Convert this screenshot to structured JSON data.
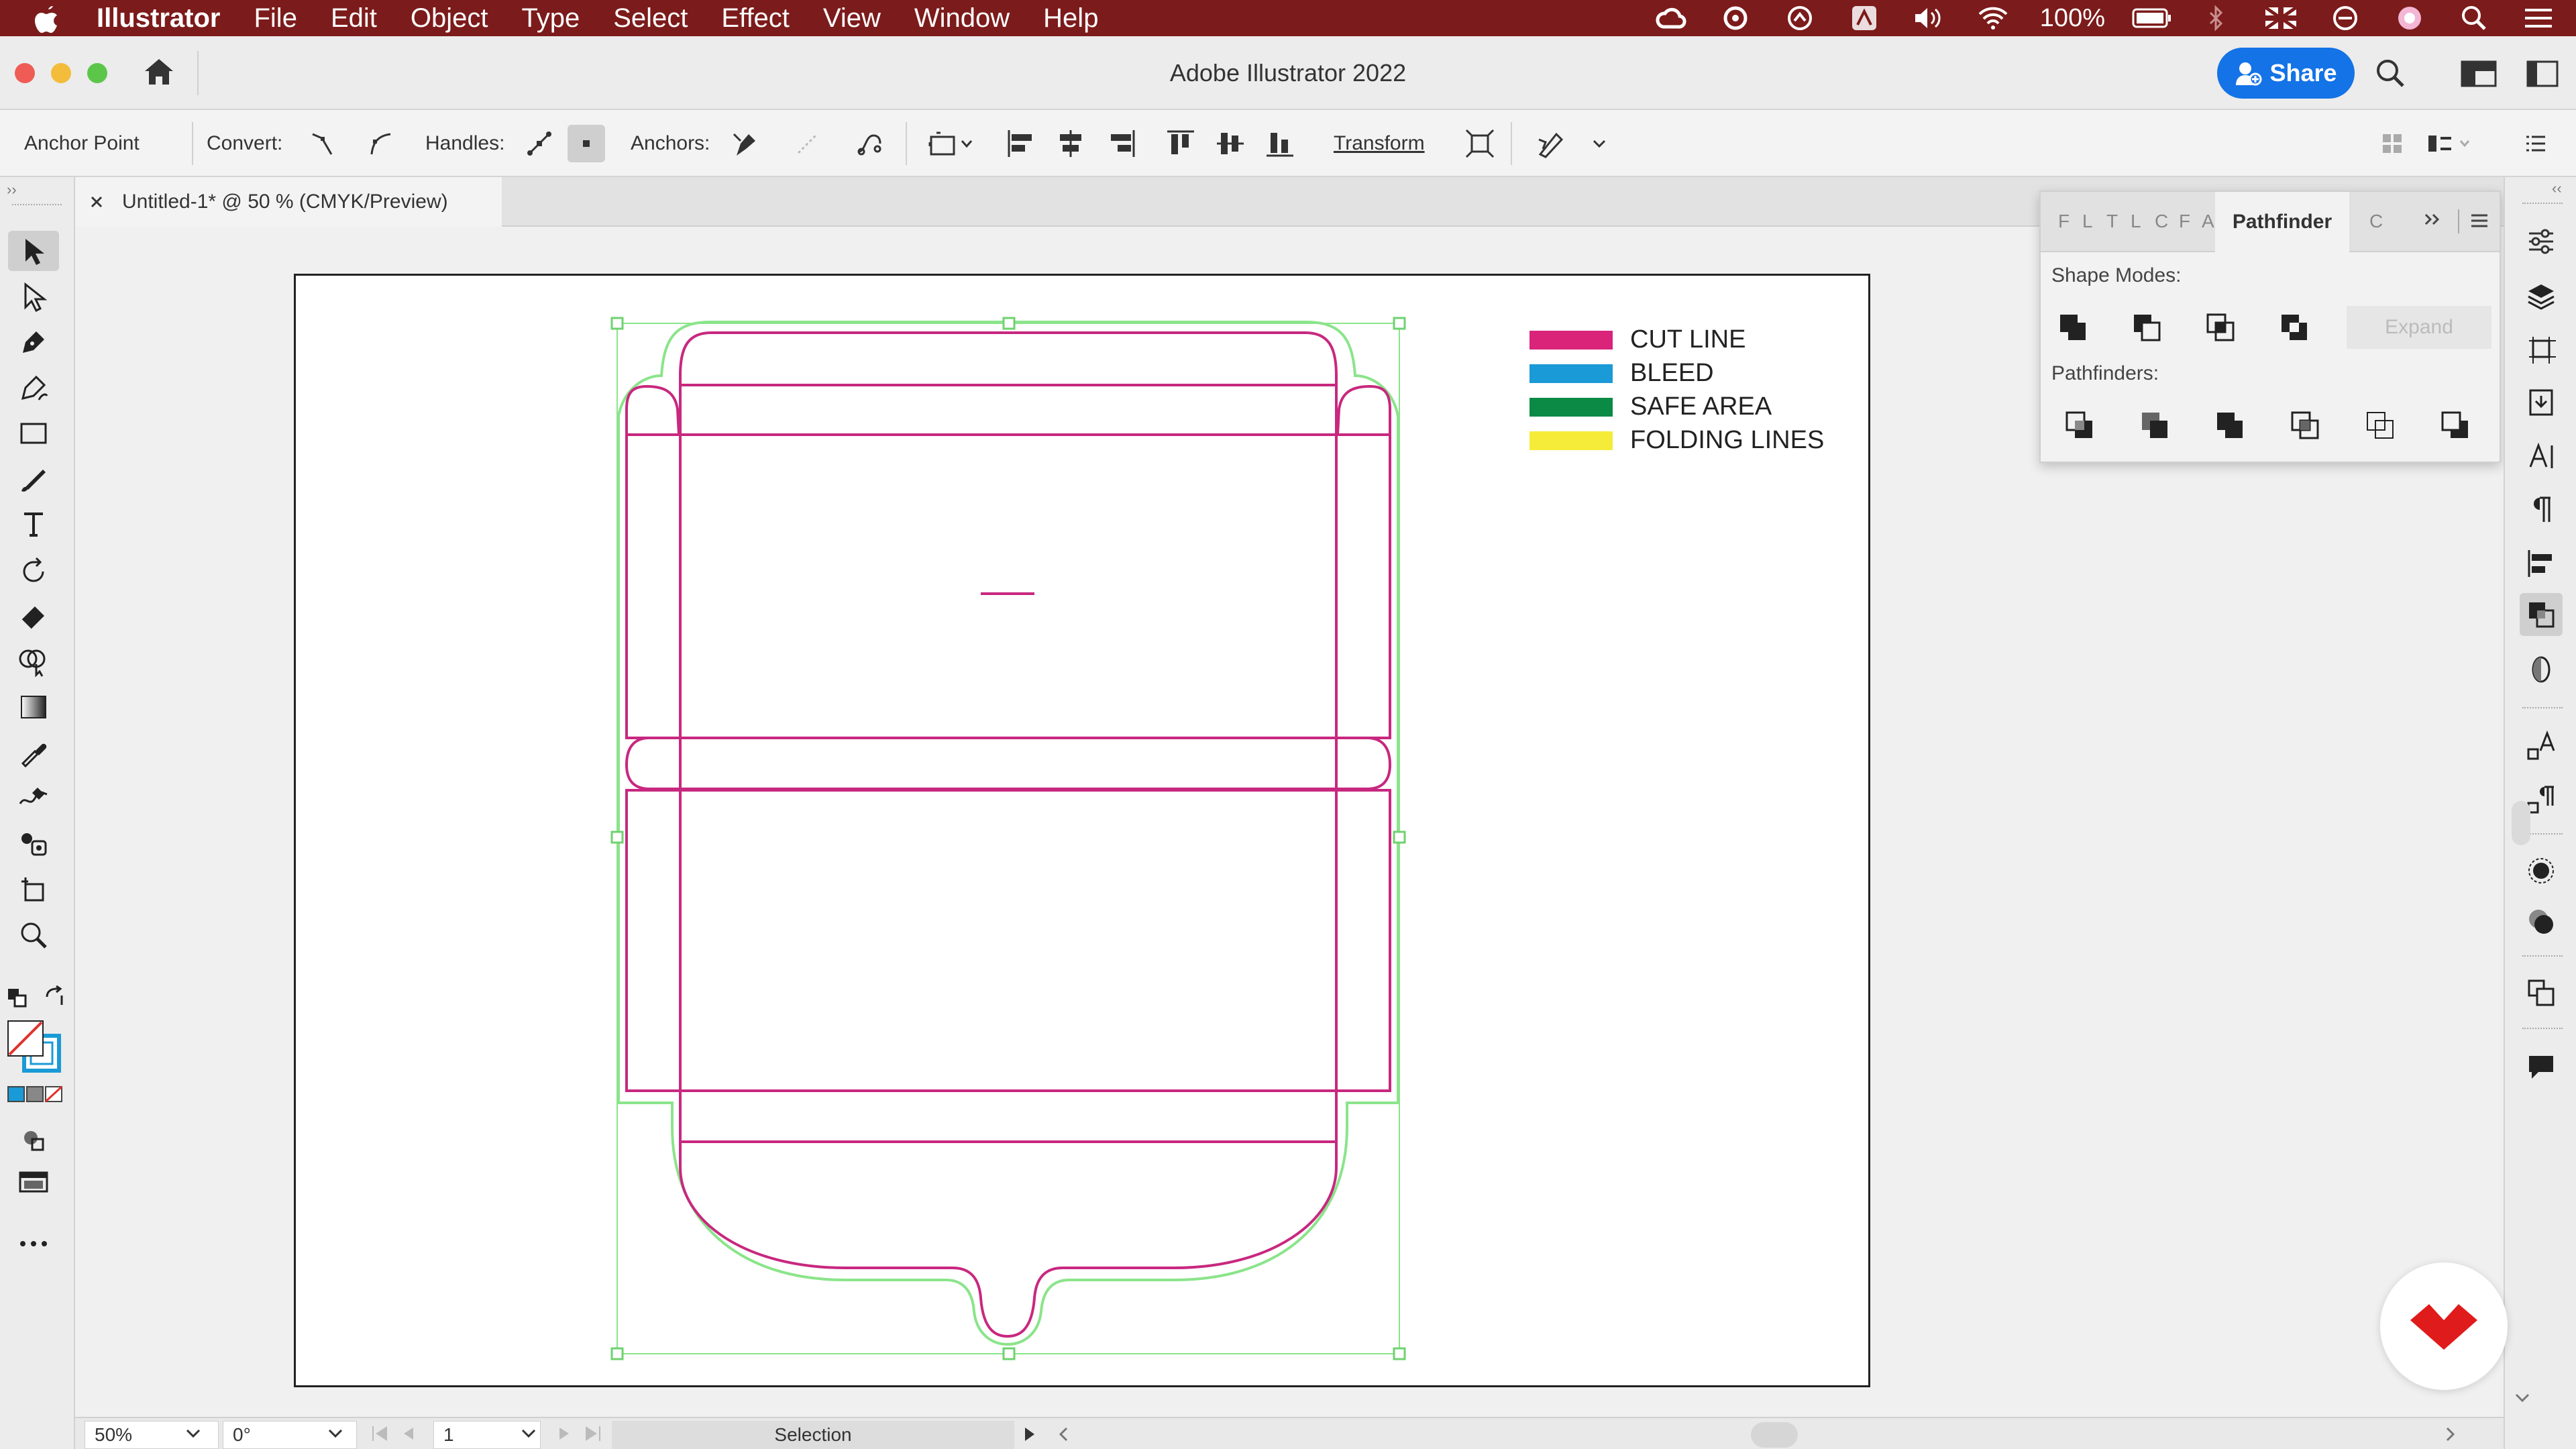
{
  "menubar": {
    "app": "Illustrator",
    "items": [
      "File",
      "Edit",
      "Object",
      "Type",
      "Select",
      "Effect",
      "View",
      "Window",
      "Help"
    ],
    "battery": "100%"
  },
  "window": {
    "title": "Adobe Illustrator 2022",
    "share_label": "Share"
  },
  "control_bar": {
    "anchor_point": "Anchor Point",
    "convert_label": "Convert:",
    "handles_label": "Handles:",
    "anchors_label": "Anchors:",
    "transform_label": "Transform"
  },
  "document": {
    "tab_title": "Untitled-1* @ 50 % (CMYK/Preview)"
  },
  "legend": [
    {
      "label": "CUT LINE",
      "color": "#d9247a"
    },
    {
      "label": "BLEED",
      "color": "#1a9ad6"
    },
    {
      "label": "SAFE AREA",
      "color": "#0b8a46"
    },
    {
      "label": "FOLDING LINES",
      "color": "#f5ec3a"
    }
  ],
  "pathfinder": {
    "tab_title": "Pathfinder",
    "collapsed_tabs": [
      "F",
      "L",
      "T",
      "L",
      "C",
      "F",
      "A"
    ],
    "extra_tab": "C",
    "shape_modes_label": "Shape Modes:",
    "expand_label": "Expand",
    "pathfinders_label": "Pathfinders:"
  },
  "status_bar": {
    "zoom": "50%",
    "rotation": "0°",
    "artboard": "1",
    "tool": "Selection"
  },
  "colors": {
    "menubar": "#7c1b1b",
    "accent": "#1473e6",
    "cut_line": "#c8287f",
    "bleed_guide": "#7ee07e"
  }
}
